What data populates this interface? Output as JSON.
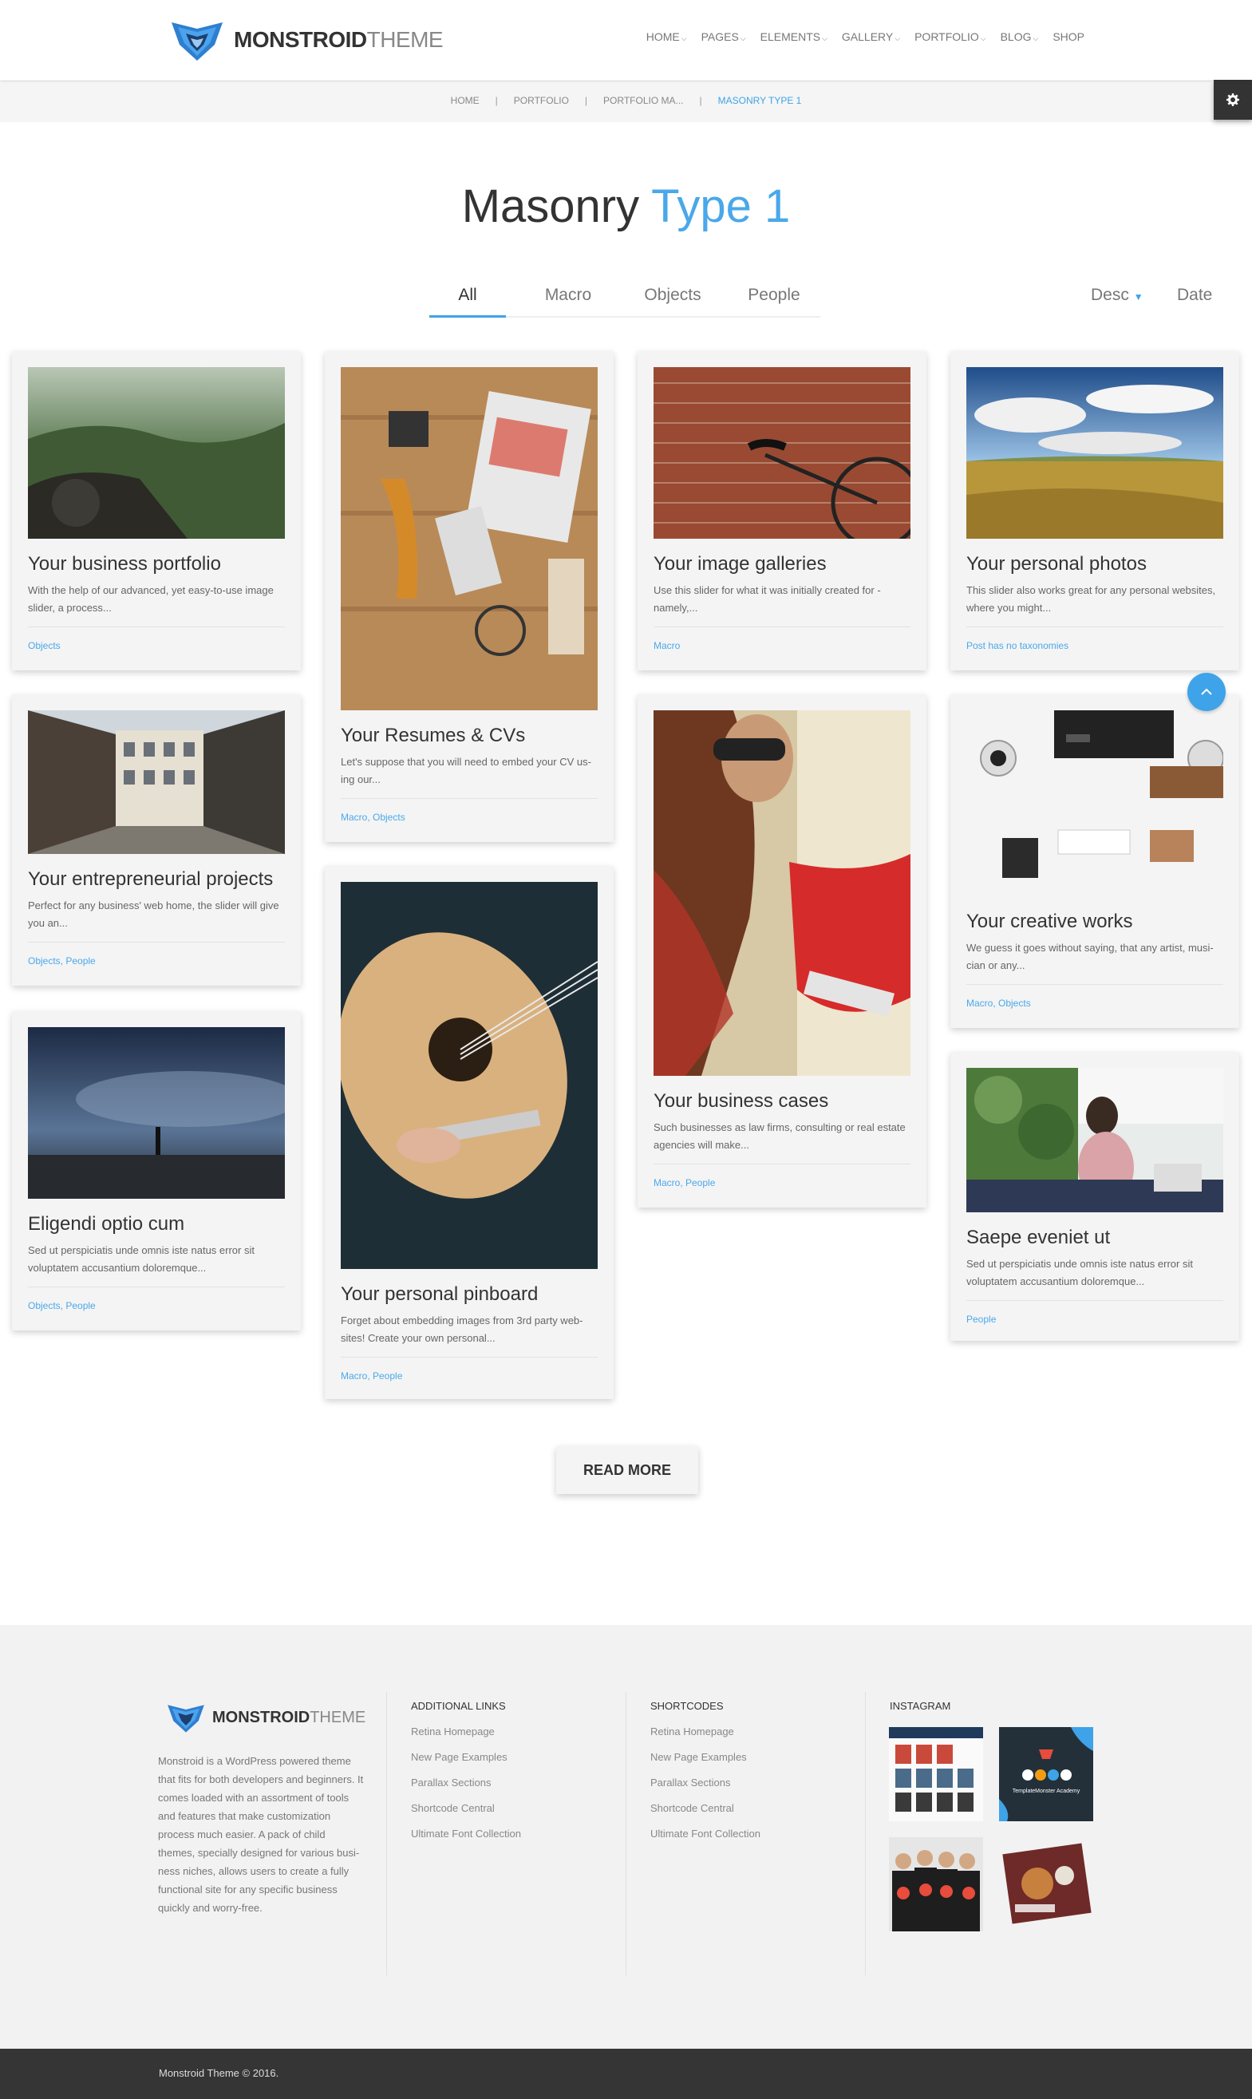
{
  "brand": {
    "bold": "MONSTROID",
    "light": "THEME"
  },
  "nav": [
    {
      "label": "HOME",
      "caret": true
    },
    {
      "label": "PAGES",
      "caret": true
    },
    {
      "label": "ELEMENTS",
      "caret": true
    },
    {
      "label": "GALLERY",
      "caret": true
    },
    {
      "label": "PORTFOLIO",
      "caret": true
    },
    {
      "label": "BLOG",
      "caret": true
    },
    {
      "label": "SHOP",
      "caret": false
    }
  ],
  "breadcrumb": [
    "HOME",
    "PORTFOLIO",
    "PORTFOLIO MA...",
    "MASONRY TYPE 1"
  ],
  "title": {
    "main": "Masonry",
    "accent": "Type 1"
  },
  "filters": [
    "All",
    "Macro",
    "Objects",
    "People"
  ],
  "sort": {
    "order": "Desc",
    "by": "Date"
  },
  "cards": [
    {
      "title": "Your business portfolio",
      "desc": "With the help of our advanced, yet easy-to-use image slider, a process...",
      "tax": "Objects"
    },
    {
      "title": "Your Resumes & CVs",
      "desc": "Let's suppose that you will need to embed your CV us-ing our...",
      "tax": "Macro, Objects"
    },
    {
      "title": "Your image galleries",
      "desc": "Use this slider for what it was initially created for - namely,...",
      "tax": "Macro"
    },
    {
      "title": "Your personal photos",
      "desc": "This slider also works great for any personal websites, where you might...",
      "tax": "Post has no taxonomies"
    },
    {
      "title": "Your entrepreneurial projects",
      "desc": "Perfect for any business' web home, the slider will give you an...",
      "tax": "Objects, People"
    },
    {
      "title": "Your personal pinboard",
      "desc": "Forget about embedding images from 3rd party web-sites! Create your own personal...",
      "tax": "Macro, People"
    },
    {
      "title": "Your business cases",
      "desc": "Such businesses as law firms, consulting or real estate agencies will make...",
      "tax": "Macro, People"
    },
    {
      "title": "Your creative works",
      "desc": "We guess it goes without saying, that any artist, musi-cian or any...",
      "tax": "Macro, Objects"
    },
    {
      "title": "Eligendi optio cum",
      "desc": "Sed ut perspiciatis unde omnis iste natus error sit voluptatem accusantium doloremque...",
      "tax": "Objects, People"
    },
    {
      "title": "Saepe eveniet ut",
      "desc": "Sed ut perspiciatis unde omnis iste natus error sit voluptatem accusantium doloremque...",
      "tax": "People"
    }
  ],
  "read_more": "READ MORE",
  "footer": {
    "about": "Monstroid is a WordPress powered theme that fits for both developers and beginners. It comes loaded with an assortment of tools and features that make customization process much easier. A pack of child themes, specially designed for various busi-ness niches, allows users to create a fully functional site for any specific business quickly and worry-free.",
    "col1": {
      "heading": "ADDITIONAL LINKS",
      "links": [
        "Retina Homepage",
        "New Page Examples",
        "Parallax Sections",
        "Shortcode Central",
        "Ultimate Font Collection"
      ]
    },
    "col2": {
      "heading": "SHORTCODES",
      "links": [
        "Retina Homepage",
        "New Page Examples",
        "Parallax Sections",
        "Shortcode Central",
        "Ultimate Font Collection"
      ]
    },
    "col3": {
      "heading": "INSTAGRAM",
      "academy_label": "TemplateMonster Academy"
    },
    "copyright": "Monstroid Theme © 2016."
  },
  "colors": {
    "accent": "#3ea3e8",
    "dark": "#333333",
    "footer_bar": "#353535"
  }
}
